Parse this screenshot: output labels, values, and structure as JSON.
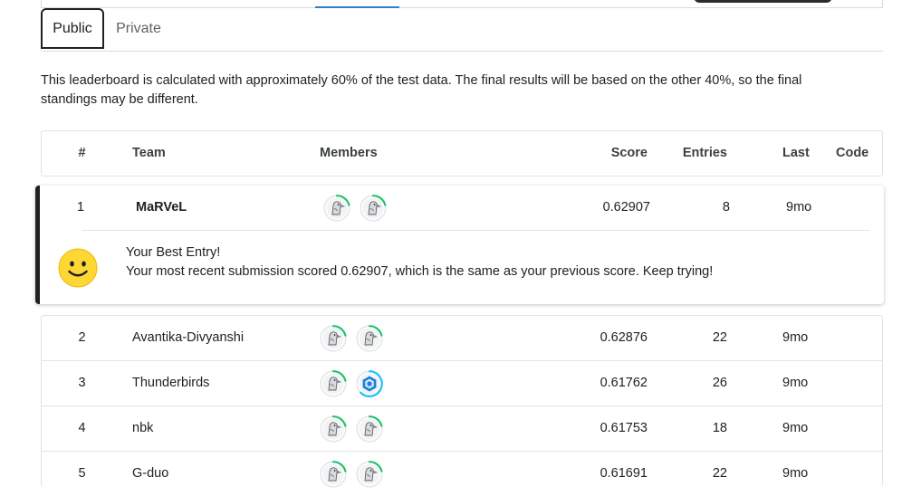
{
  "tabs": [
    {
      "label": "Public",
      "active": true
    },
    {
      "label": "Private",
      "active": false
    }
  ],
  "notice": "This leaderboard is calculated with approximately 60% of the test data. The final results will be based on the other 40%, so the final standings may be different.",
  "columns": {
    "rank": "#",
    "team": "Team",
    "members": "Members",
    "score": "Score",
    "entries": "Entries",
    "last": "Last",
    "code": "Code"
  },
  "highlight_row": {
    "rank": "1",
    "team": "MaRVeL",
    "score": "0.62907",
    "entries": "8",
    "last": "9mo",
    "avatars": [
      "goose-avatar",
      "goose-avatar"
    ]
  },
  "best_entry": {
    "title": "Your Best Entry!",
    "message": "Your most recent submission scored 0.62907, which is the same as your previous score. Keep trying!"
  },
  "rows": [
    {
      "rank": "2",
      "team": "Avantika-Divyanshi",
      "score": "0.62876",
      "entries": "22",
      "last": "9mo",
      "avatars": [
        "goose-avatar",
        "goose-avatar"
      ]
    },
    {
      "rank": "3",
      "team": "Thunderbirds",
      "score": "0.61762",
      "entries": "26",
      "last": "9mo",
      "avatars": [
        "goose-avatar",
        "hexagon-avatar"
      ]
    },
    {
      "rank": "4",
      "team": "nbk",
      "score": "0.61753",
      "entries": "18",
      "last": "9mo",
      "avatars": [
        "goose-avatar",
        "goose-avatar"
      ]
    },
    {
      "rank": "5",
      "team": "G-duo",
      "score": "0.61691",
      "entries": "22",
      "last": "9mo",
      "avatars": [
        "goose-avatar",
        "goose-avatar"
      ]
    }
  ],
  "colors": {
    "progress_ring": "#20beff",
    "progress_ring_green": "#1fc36b",
    "accent_bar": "#202124",
    "tab_indicator": "#2f80c7"
  }
}
